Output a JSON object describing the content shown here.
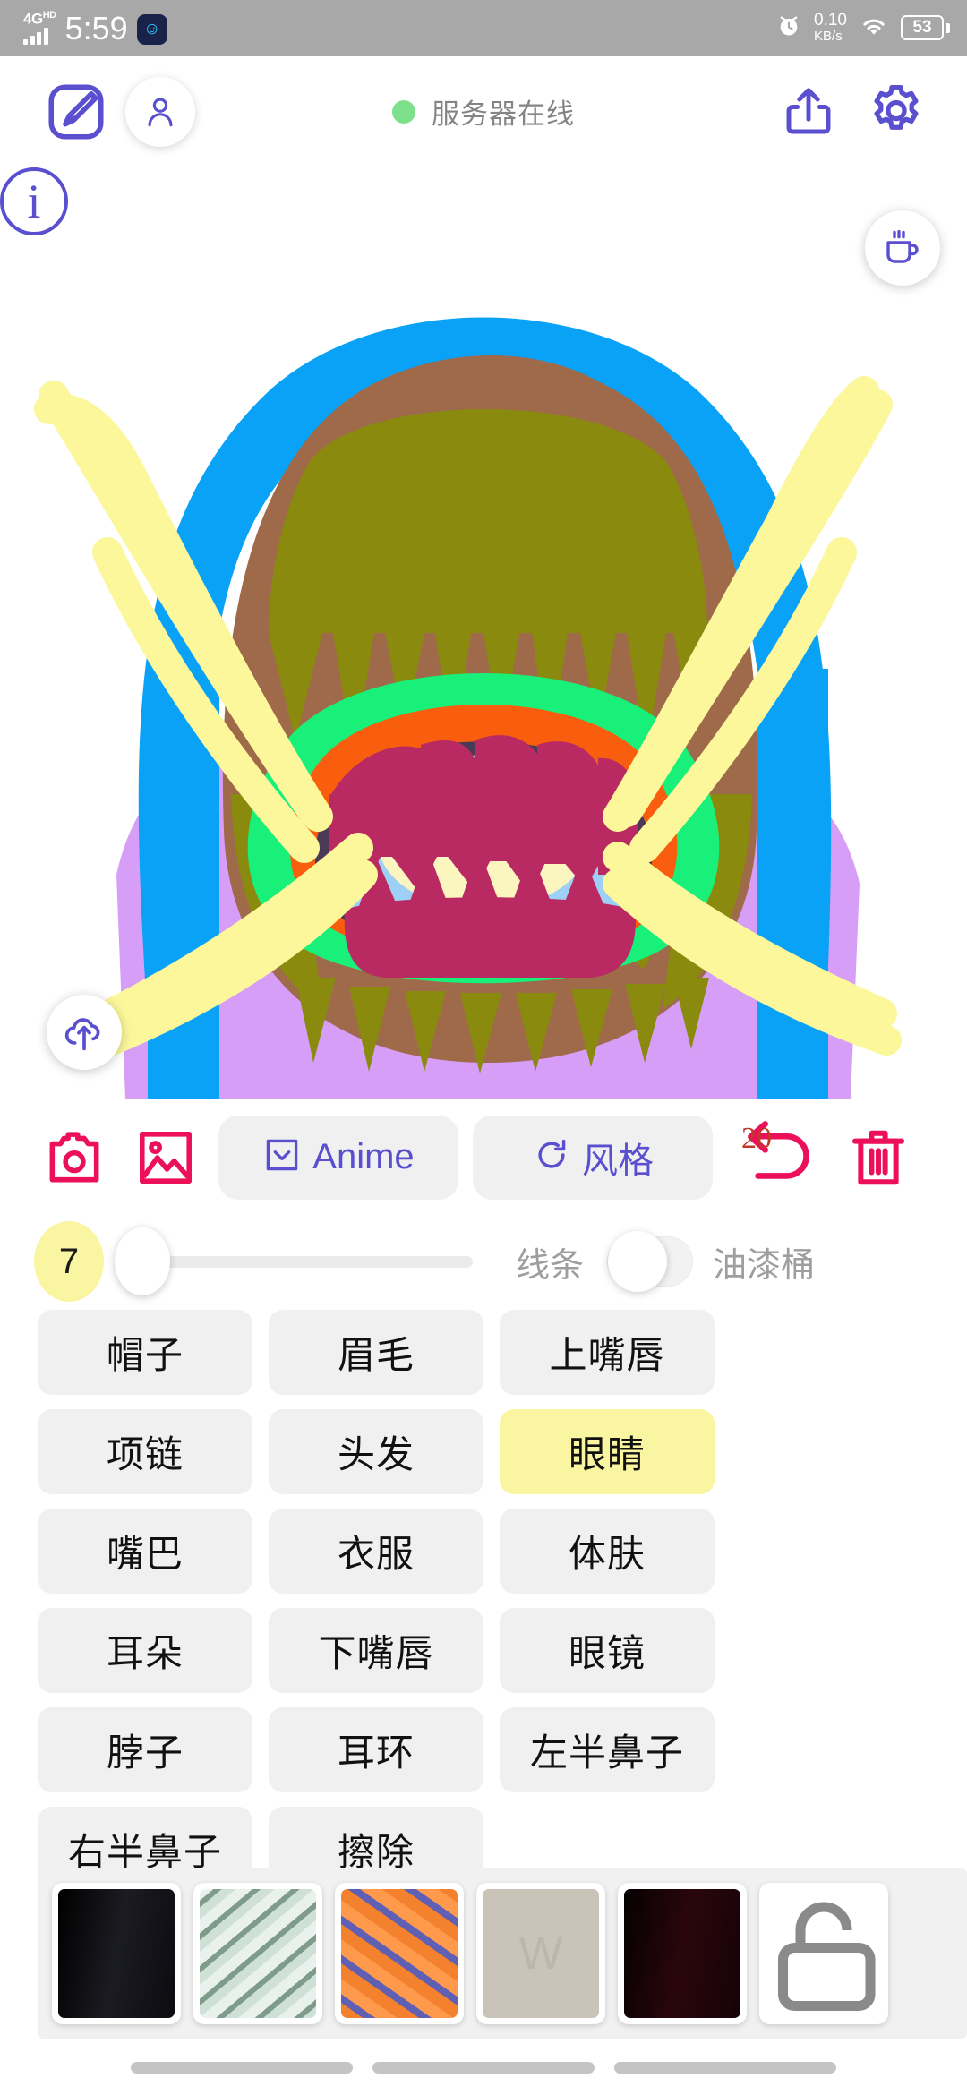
{
  "status_bar": {
    "network_type": "4G",
    "network_sub": "HD",
    "clock": "5:59",
    "app_badge_icon": "smiley-badge-icon",
    "alarm_icon": "alarm-clock-icon",
    "data_speed_value": "0.10",
    "data_speed_unit": "KB/s",
    "wifi_icon": "wifi-icon",
    "battery_level": "53"
  },
  "header": {
    "brush_icon": "brush-square-icon",
    "avatar_icon": "person-icon",
    "server_status_label": "服务器在线",
    "server_status_color": "#7de08a",
    "share_icon": "share-upload-icon",
    "settings_icon": "gear-icon"
  },
  "canvas": {
    "coffee_icon": "coffee-cup-icon",
    "upload_icon": "cloud-upload-icon",
    "info_glyph": "i",
    "palette": {
      "sky_blue": "#0aa2f7",
      "brown": "#9e6a4a",
      "olive": "#8a8a0e",
      "green": "#19f07a",
      "orange": "#f85e0d",
      "magenta": "#b92a62",
      "light_blue": "#9ed0f5",
      "cream": "#fbf5c0",
      "violet": "#d69ef7",
      "yellow_stroke": "#fbf79a",
      "outline": "#4a3a55"
    }
  },
  "toolbar": {
    "camera_icon": "camera-icon",
    "gallery_icon": "image-icon",
    "anime_label": "Anime",
    "anime_icon": "square-chevron-down-icon",
    "style_label": "风格",
    "style_icon": "refresh-ccw-icon",
    "undo_icon": "undo-arrow-icon",
    "undo_count": "20",
    "trash_icon": "trash-icon",
    "accent_pink": "#ec1059",
    "accent_purple": "#5a4fcf"
  },
  "brush_controls": {
    "size_value": "7",
    "slider_percent": 0,
    "line_label": "线条",
    "bucket_label": "油漆桶",
    "bucket_enabled": false
  },
  "label_grid": {
    "selected": "眼睛",
    "chips": [
      "帽子",
      "眉毛",
      "上嘴唇",
      "项链",
      "头发",
      "眼睛",
      "嘴巴",
      "衣服",
      "体肤",
      "耳朵",
      "下嘴唇",
      "眼镜",
      "脖子",
      "耳环",
      "左半鼻子",
      "右半鼻子",
      "擦除"
    ]
  },
  "thumb_gallery": {
    "items": [
      {
        "name": "thumb-black-fabric",
        "c1": "#0b0b10",
        "c2": "#1b1b22",
        "c3": "#000000"
      },
      {
        "name": "thumb-green-glass",
        "c1": "#cfe0d7",
        "c2": "#7f9b8c",
        "c3": "#e8f1ec"
      },
      {
        "name": "thumb-orange-abstract",
        "c1": "#f3812e",
        "c2": "#5f5fb4",
        "c3": "#ff9a4d"
      },
      {
        "name": "thumb-beige-w",
        "c1": "#c9c3b8",
        "c2": "#bdb7ab",
        "c3": "#d3cdc2"
      },
      {
        "name": "thumb-dark-red",
        "c1": "#150306",
        "c2": "#2a060c",
        "c3": "#050101"
      },
      {
        "name": "thumb-lock-placeholder",
        "c1": "#ffffff",
        "c2": "#8a8a8a",
        "c3": "#ffffff"
      }
    ]
  },
  "nav_bar": {
    "back_pill": "nav-back",
    "home_pill": "nav-home",
    "recents_pill": "nav-recents"
  }
}
